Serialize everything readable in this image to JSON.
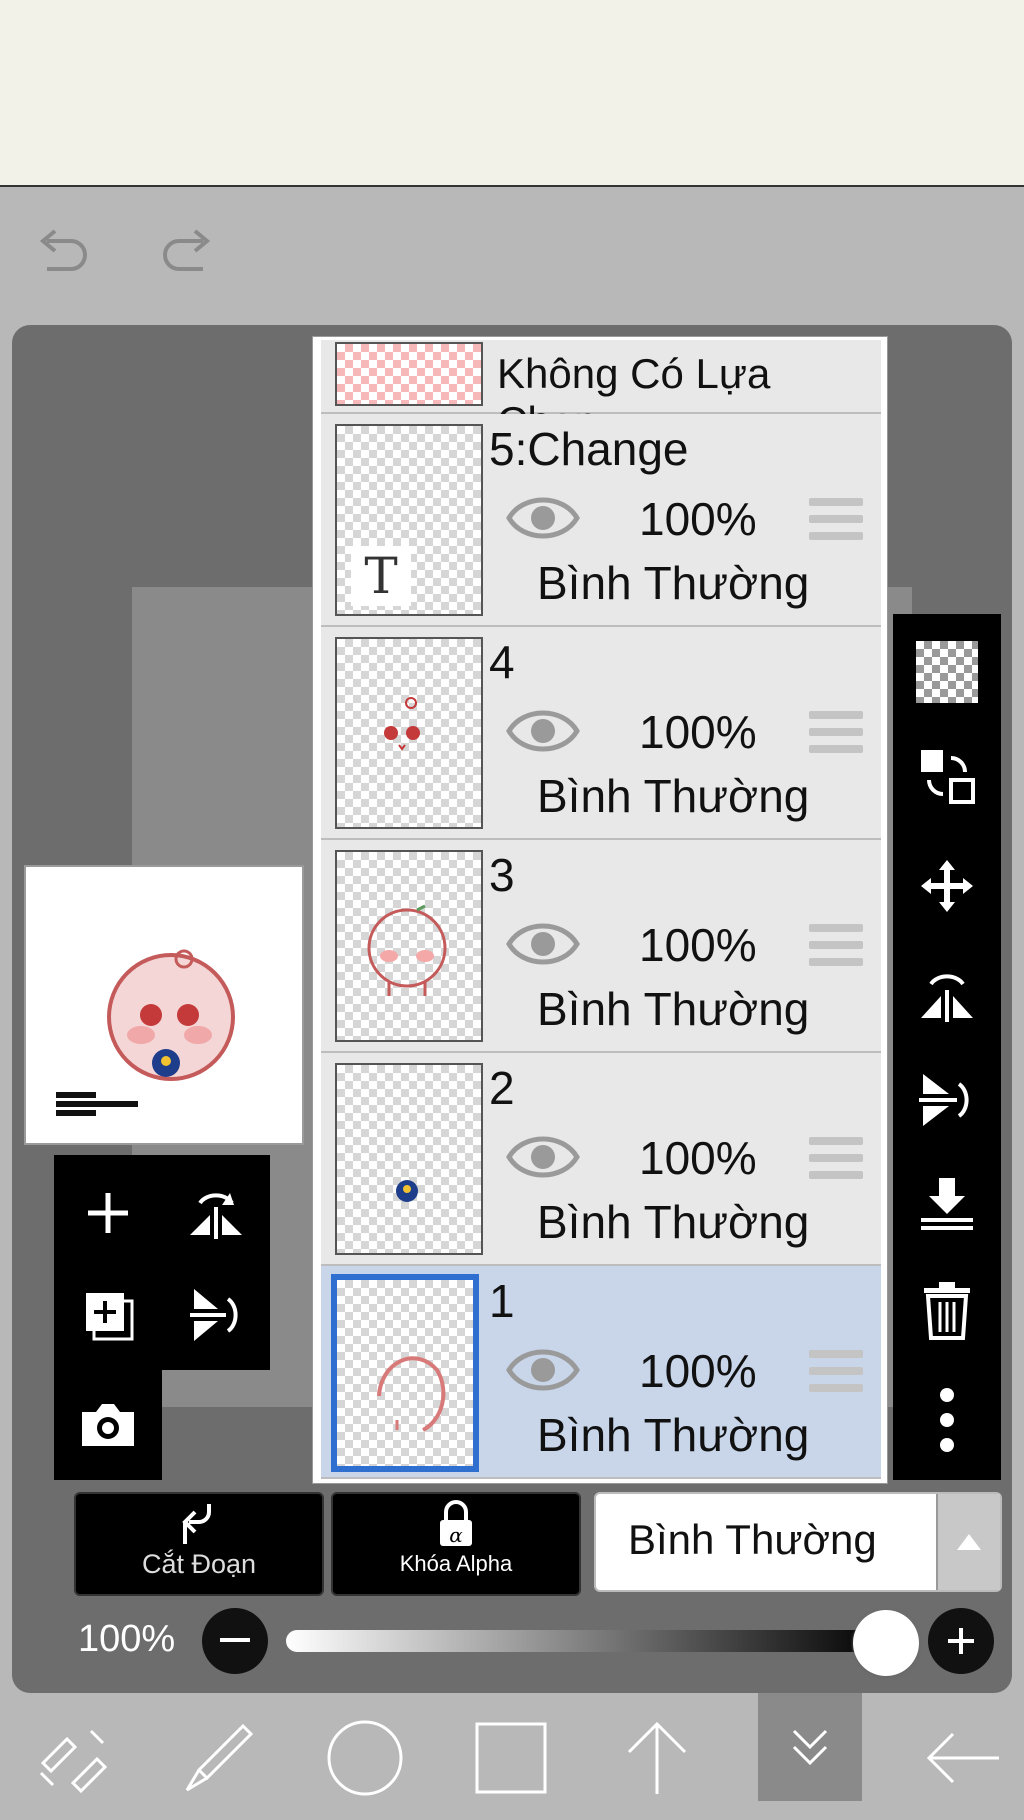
{
  "toolbar": {
    "undo_icon": "undo-icon",
    "redo_icon": "redo-icon"
  },
  "layers": {
    "selection_row": {
      "label": "Không Có Lựa Chọn"
    },
    "items": [
      {
        "name": "5:Change",
        "opacity": "100%",
        "blend": "Bình Thường",
        "visible": true,
        "selected": false,
        "thumb_glyph": "T"
      },
      {
        "name": "4",
        "opacity": "100%",
        "blend": "Bình Thường",
        "visible": true,
        "selected": false
      },
      {
        "name": "3",
        "opacity": "100%",
        "blend": "Bình Thường",
        "visible": true,
        "selected": false
      },
      {
        "name": "2",
        "opacity": "100%",
        "blend": "Bình Thường",
        "visible": true,
        "selected": false
      },
      {
        "name": "1",
        "opacity": "100%",
        "blend": "Bình Thường",
        "visible": true,
        "selected": true
      }
    ]
  },
  "actions": {
    "clipping_label": "Cắt Đoạn",
    "alpha_lock_label": "Khóa Alpha",
    "blend_mode_value": "Bình Thường"
  },
  "opacity_slider": {
    "label": "100%",
    "value": 1.0
  },
  "colors": {
    "accent": "#2f6fd0",
    "selected_row": "#c9d6ea",
    "panel_bg": "#e8e8e8",
    "topbar": "#f2f2e9"
  }
}
